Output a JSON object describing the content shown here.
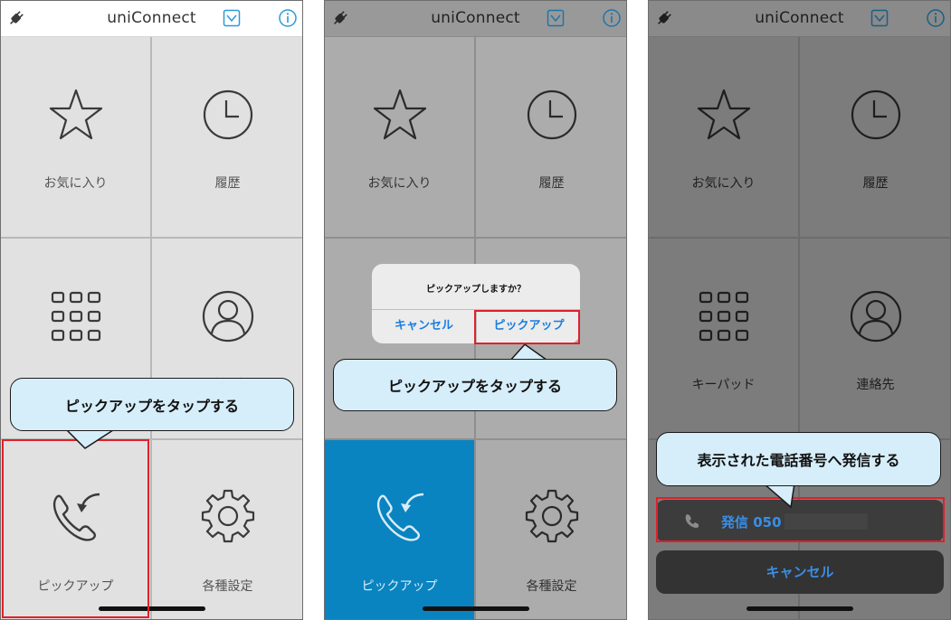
{
  "app": {
    "title": "uniConnect"
  },
  "menu": {
    "favorites": "お気に入り",
    "history": "履歴",
    "keypad": "キーパッド",
    "contacts": "連絡先",
    "pickup": "ピックアップ",
    "settings": "各種設定"
  },
  "dialog": {
    "message": "ピックアップしますか？",
    "cancel": "キャンセル",
    "confirm": "ピックアップ"
  },
  "sheet": {
    "call": "発信 050",
    "cancel": "キャンセル"
  },
  "callouts": {
    "step1": "ピックアップをタップする",
    "step2": "ピックアップをタップする",
    "step3": "表示された電話番号へ発信する"
  },
  "colors": {
    "accent_blue": "#1a7de0",
    "pickup_active": "#0a84c0",
    "highlight_red": "#e0202a",
    "callout_fill": "#d6eefa"
  },
  "icons": [
    "plug-icon",
    "trend-icon",
    "info-icon",
    "star-icon",
    "clock-icon",
    "keypad-icon",
    "person-icon",
    "phone-pickup-icon",
    "gear-icon",
    "phone-icon"
  ]
}
